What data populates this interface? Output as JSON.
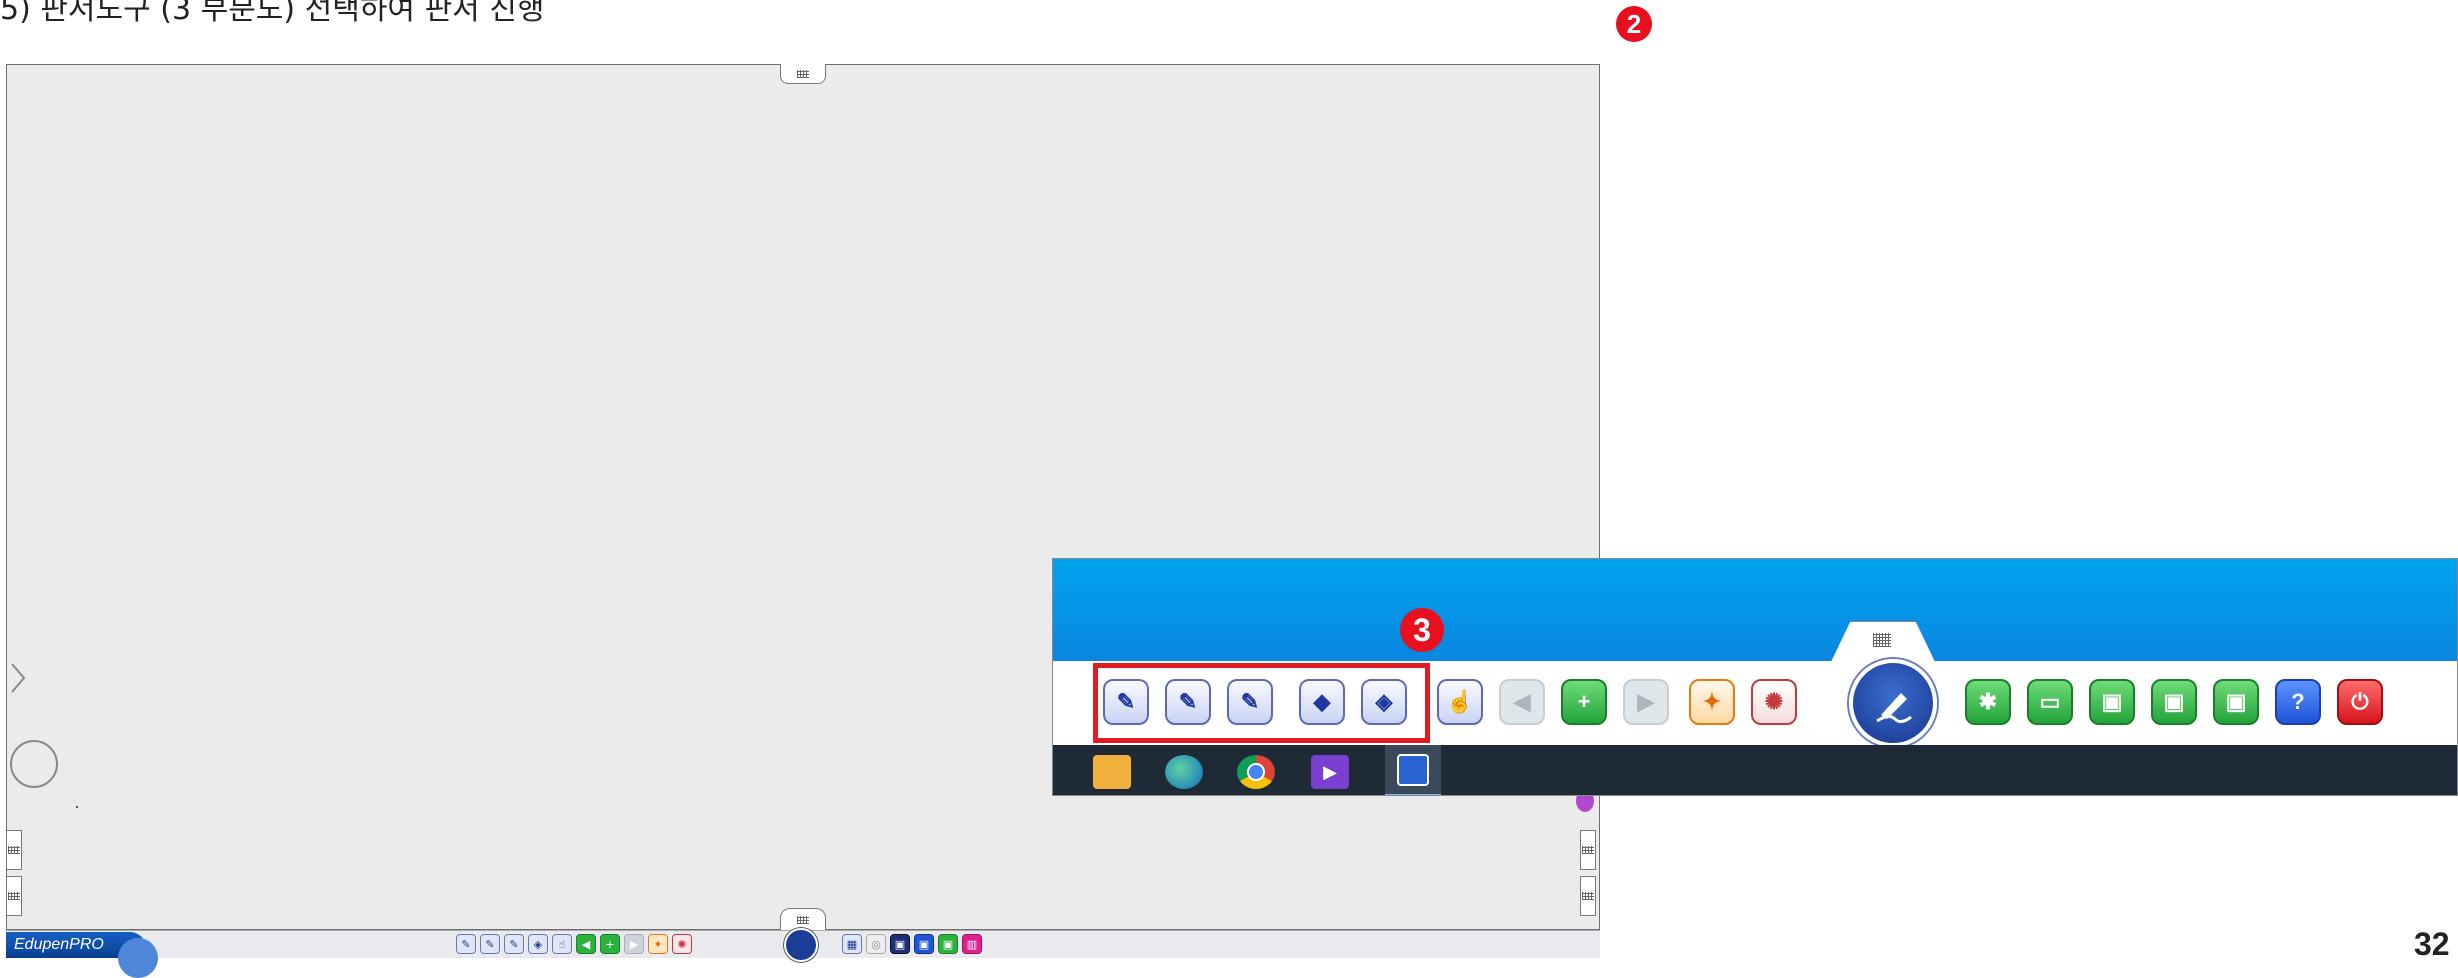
{
  "caption": "5) 판서도구 (3 부분도) 선택하여 판서 진행",
  "badges": {
    "two": "2",
    "three": "3"
  },
  "page_number": "32",
  "app": {
    "logo_text": "EdupenPRO"
  },
  "colors": {
    "badge_red": "#e8101e",
    "highlight_red": "#e01b24",
    "board_bg": "#ebebeb",
    "zoom_blue": "#00a3ee",
    "taskbar": "#1e2a36"
  },
  "toolbar": {
    "tools": [
      "pen-icon",
      "brush-icon",
      "marker-icon",
      "shapes-icon",
      "eraser-icon"
    ],
    "actions": [
      "pointer-hand-icon",
      "back-arrow-icon",
      "new-page-icon",
      "forward-arrow-icon",
      "wrench-icon",
      "gear-icon"
    ],
    "center": "edupen-logo-icon",
    "file": [
      "new-file-icon",
      "open-folder-icon",
      "save-icon",
      "save-as-icon",
      "save-xps-icon",
      "help-icon",
      "power-icon"
    ],
    "help_glyph": "?"
  },
  "taskbar": {
    "apps": [
      "file-explorer-icon",
      "edge-icon",
      "chrome-icon",
      "visual-studio-icon",
      "edupen-app-icon"
    ]
  }
}
